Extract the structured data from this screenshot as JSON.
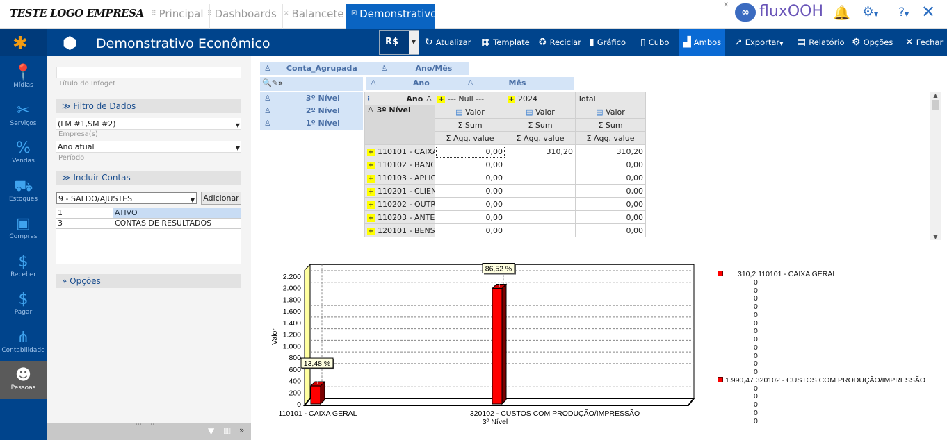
{
  "app": {
    "logo_text": "TESTE LOGO EMPRESA",
    "brand": "fluxOOH",
    "tabs": [
      {
        "label": "Principal"
      },
      {
        "label": "Dashboards"
      },
      {
        "label": "Balancete"
      },
      {
        "label": "Demonstrativo",
        "active": true
      }
    ]
  },
  "toolbar": {
    "title": "Demonstrativo Econômico",
    "currency": "R$",
    "buttons": [
      {
        "label": "Atualizar",
        "icon": "refresh-icon"
      },
      {
        "label": "Template",
        "icon": "template-icon"
      },
      {
        "label": "Reciclar",
        "icon": "recycle-icon"
      },
      {
        "label": "Gráfico",
        "icon": "bar-chart-icon"
      },
      {
        "label": "Cubo",
        "icon": "cube-icon"
      },
      {
        "label": "Ambos",
        "icon": "both-icon",
        "active": true
      },
      {
        "label": "Exportar",
        "icon": "export-icon"
      },
      {
        "label": "Relatório",
        "icon": "report-icon"
      },
      {
        "label": "Opções",
        "icon": "gear-icon"
      },
      {
        "label": "Fechar",
        "icon": "close-icon"
      }
    ]
  },
  "nav": [
    {
      "label": "Mídias",
      "icon": "pin-icon"
    },
    {
      "label": "Serviços",
      "icon": "tools-icon"
    },
    {
      "label": "Vendas",
      "icon": "percent-icon"
    },
    {
      "label": "Estoques",
      "icon": "cart-icon"
    },
    {
      "label": "Compras",
      "icon": "box-icon"
    },
    {
      "label": "Receber",
      "icon": "dollar-icon"
    },
    {
      "label": "Pagar",
      "icon": "money-icon"
    },
    {
      "label": "Contabilidade",
      "icon": "network-icon"
    },
    {
      "label": "Pessoas",
      "icon": "person-icon",
      "active": true
    }
  ],
  "left": {
    "title_value": "",
    "title_hint": "Título do Infoget",
    "filter_section": "Filtro de Dados",
    "empresa_value": "(LM #1,SM #2)",
    "empresa_hint": "Empresa(s)",
    "periodo_value": "Ano atual",
    "periodo_hint": "Período",
    "contas_section": "Incluir Contas",
    "contas_select": "9 - SALDO/AJUSTES",
    "add_label": "Adicionar",
    "contas": [
      {
        "code": "1",
        "name": "ATIVO",
        "selected": true
      },
      {
        "code": "3",
        "name": "CONTAS DE RESULTADOS"
      }
    ],
    "options_section": "Opções"
  },
  "pivot": {
    "filter_fields": [
      "Conta_Agrupada",
      "Ano/Mês"
    ],
    "column_fields": [
      "Ano",
      "Mês"
    ],
    "row_fields": [
      "3º Nível",
      "2º Nível",
      "1º Nível"
    ],
    "corner_col": "Ano",
    "corner_row": "3º Nível",
    "columns": [
      "--- Null ---",
      "2024",
      "Total"
    ],
    "measure": "Valor",
    "sum": "Sum",
    "agg": "Agg. value",
    "rows": [
      {
        "label": "110101 - CAIXA",
        "values": [
          "0,00",
          "310,20",
          "310,20"
        ]
      },
      {
        "label": "110102 - BANCO",
        "values": [
          "0,00",
          "",
          "0,00"
        ]
      },
      {
        "label": "110103 - APLICA",
        "values": [
          "0,00",
          "",
          "0,00"
        ]
      },
      {
        "label": "110201 - CLIENT",
        "values": [
          "0,00",
          "",
          "0,00"
        ]
      },
      {
        "label": "110202 - OUTRO",
        "values": [
          "0,00",
          "",
          "0,00"
        ]
      },
      {
        "label": "110203 - ANTEC",
        "values": [
          "0,00",
          "",
          "0,00"
        ]
      },
      {
        "label": "120101 - BENS",
        "values": [
          "0,00",
          "",
          "0,00"
        ]
      }
    ]
  },
  "chart_data": {
    "type": "bar",
    "categories": [
      "110101 - CAIXA GERAL",
      "320102 - CUSTOS COM PRODUÇÃO/IMPRESSÃO"
    ],
    "values": [
      310.2,
      1990.47
    ],
    "data_labels": [
      "13,48 %",
      "86,52 %"
    ],
    "xlabel": "3º Nível",
    "ylabel": "Valor",
    "ylim": [
      0,
      2400
    ],
    "yticks": [
      "0",
      "200",
      "400",
      "600",
      "800",
      "1.000",
      "1.200",
      "1.400",
      "1.600",
      "1.800",
      "2.000",
      "2.200"
    ],
    "grid": true,
    "bar_color": "#ff0000",
    "legend_position": "right",
    "legend": [
      {
        "text": "310,2 110101 - CAIXA GERAL",
        "swatch": true
      },
      {
        "text": "0"
      },
      {
        "text": "0"
      },
      {
        "text": "0"
      },
      {
        "text": "0"
      },
      {
        "text": "0"
      },
      {
        "text": "0"
      },
      {
        "text": "0"
      },
      {
        "text": "0"
      },
      {
        "text": "0"
      },
      {
        "text": "0"
      },
      {
        "text": "0"
      },
      {
        "text": "0"
      },
      {
        "text": "1.990,47 320102 - CUSTOS COM PRODUÇÃO/IMPRESSÃO",
        "swatch": true
      },
      {
        "text": "0"
      },
      {
        "text": "0"
      },
      {
        "text": "0"
      },
      {
        "text": "0"
      },
      {
        "text": "0"
      }
    ]
  }
}
